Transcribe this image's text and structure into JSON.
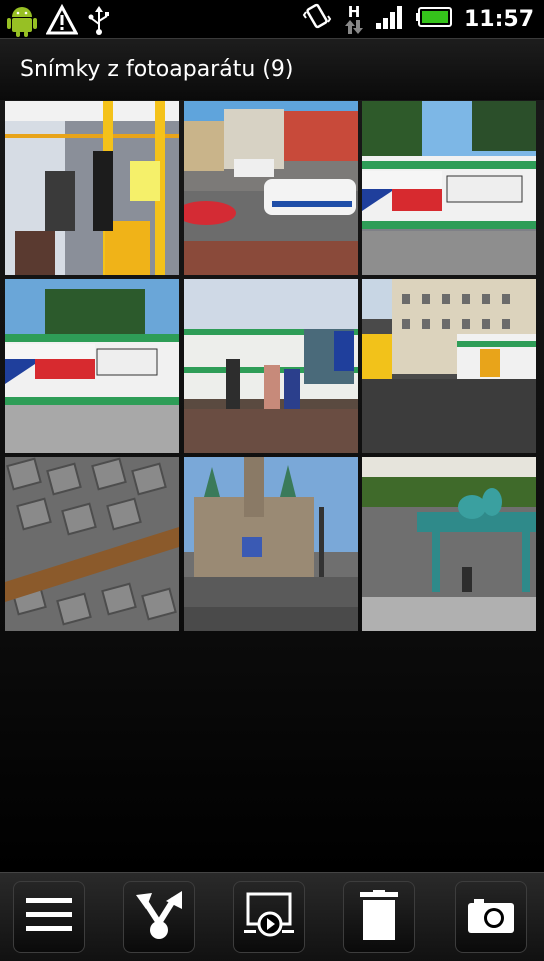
{
  "status_bar": {
    "time": "11:57",
    "network_type": "H",
    "icons": [
      "android-icon",
      "warning-icon",
      "usb-icon",
      "vibrate-icon",
      "network-h-icon",
      "signal-icon",
      "battery-icon"
    ]
  },
  "title": "Snímky z fotoaparátu (9)",
  "photos": [
    {
      "name": "tram-interior"
    },
    {
      "name": "street-police-car"
    },
    {
      "name": "tram-banner-1"
    },
    {
      "name": "tram-banner-2"
    },
    {
      "name": "tram-station-people"
    },
    {
      "name": "tram-square"
    },
    {
      "name": "cobblestone-plaque"
    },
    {
      "name": "town-hall"
    },
    {
      "name": "fountain-sculpture"
    }
  ],
  "toolbar": {
    "icons": [
      "menu-icon",
      "share-icon",
      "slideshow-icon",
      "delete-icon",
      "camera-icon"
    ]
  },
  "accent": "#3a3a3a"
}
